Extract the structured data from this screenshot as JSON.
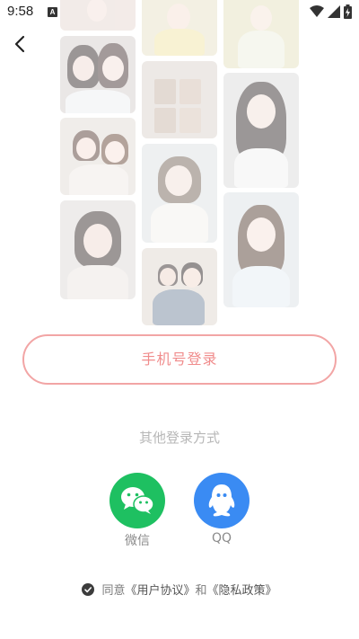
{
  "status_bar": {
    "time": "9:58",
    "notification_icon": "A"
  },
  "icons": {
    "back": "chevron-left-icon",
    "wechat": "wechat-icon",
    "qq": "qq-icon",
    "agree": "checkmark-icon",
    "wifi": "wifi-icon",
    "signal": "cell-signal-icon",
    "battery": "battery-charging-icon"
  },
  "login": {
    "phone_button": "手机号登录",
    "other_title": "其他登录方式",
    "wechat_label": "微信",
    "qq_label": "QQ"
  },
  "agreement": {
    "prefix": "同意",
    "user_agreement": "《用户协议》",
    "conjunction": "和",
    "privacy_policy": "《隐私政策》"
  },
  "colors": {
    "accent": "#f08c8c",
    "wechat": "#1ec061",
    "qq": "#3a8bf3"
  }
}
